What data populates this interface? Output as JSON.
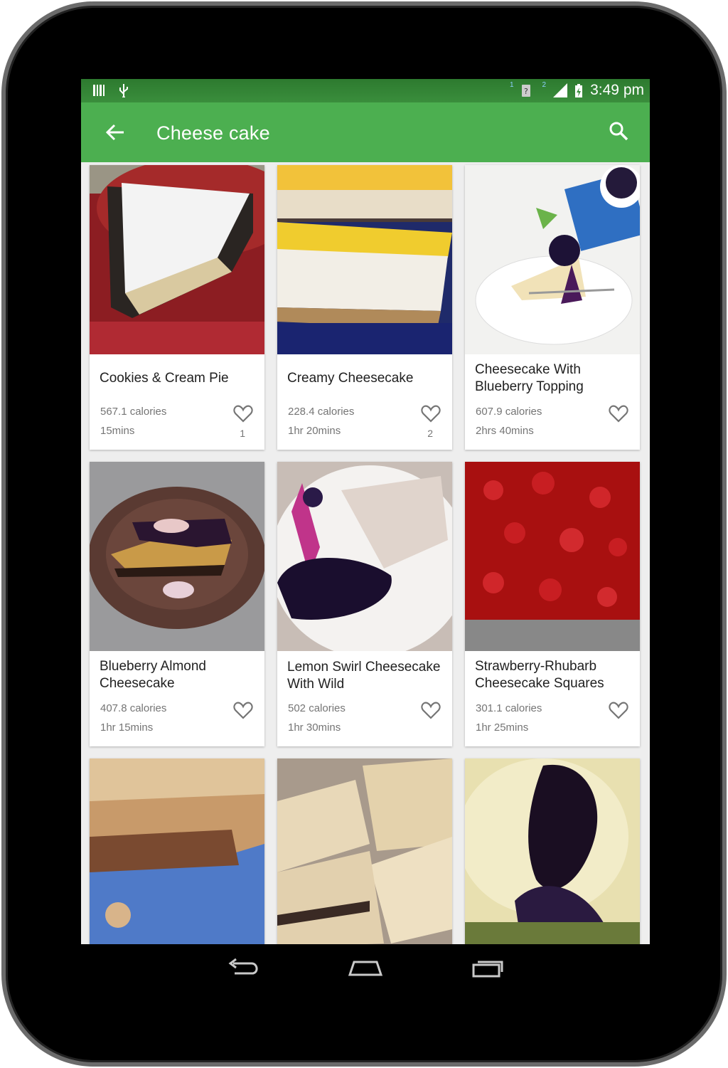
{
  "status_bar": {
    "time": "3:49 pm",
    "sim1_label": "1",
    "sim2_label": "2"
  },
  "app_bar": {
    "title": "Cheese cake"
  },
  "colors": {
    "primary": "#4caf50",
    "primary_dark": "#388e3c"
  },
  "recipes": [
    {
      "title": "Cookies & Cream Pie",
      "calories": "567.1 calories",
      "time": "15mins",
      "likes": "1",
      "image": "whipped-cream-pie-photo"
    },
    {
      "title": "Creamy Cheesecake",
      "calories": "228.4 calories",
      "time": "1hr 20mins",
      "likes": "2",
      "image": "lemon-topped-cheesecake-photo"
    },
    {
      "title": "Cheesecake With Blueberry Topping",
      "calories": "607.9 calories",
      "time": "2hrs 40mins",
      "likes": "",
      "image": "blueberry-cheesecake-plate-photo"
    },
    {
      "title": "Blueberry Almond Cheesecake",
      "calories": "407.8 calories",
      "time": "1hr 15mins",
      "likes": "",
      "image": "blueberry-almond-cheesecake-photo"
    },
    {
      "title": "Lemon Swirl Cheesecake With Wild",
      "calories": "502 calories",
      "time": "1hr 30mins",
      "likes": "",
      "image": "wild-blueberry-sauce-photo"
    },
    {
      "title": "Strawberry-Rhubarb Cheesecake Squares",
      "calories": "301.1 calories",
      "time": "1hr 25mins",
      "likes": "",
      "image": "strawberry-squares-photo"
    },
    {
      "title": "",
      "calories": "",
      "time": "",
      "likes": "",
      "image": "crumb-bar-photo"
    },
    {
      "title": "",
      "calories": "",
      "time": "",
      "likes": "",
      "image": "nut-topped-bars-photo"
    },
    {
      "title": "",
      "calories": "",
      "time": "",
      "likes": "",
      "image": "blueberry-dessert-photo"
    }
  ]
}
